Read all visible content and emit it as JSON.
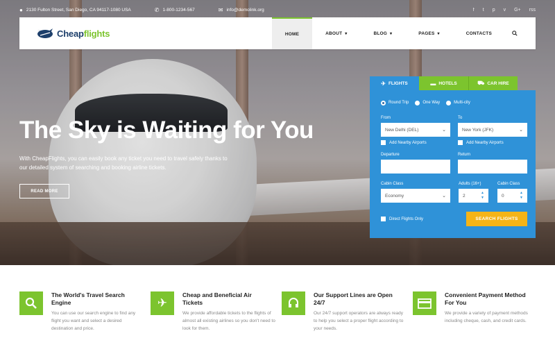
{
  "topbar": {
    "address": "2130 Fulton Street, San Diego, CA 94117-1080 USA",
    "phone": "1-800-1234-567",
    "email": "info@demolink.org",
    "socials": [
      "f",
      "t",
      "p",
      "v",
      "G+",
      "rss"
    ]
  },
  "logo": {
    "part1": "Cheap",
    "part2": "flights"
  },
  "nav": {
    "items": [
      {
        "label": "HOME"
      },
      {
        "label": "ABOUT"
      },
      {
        "label": "BLOG"
      },
      {
        "label": "PAGES"
      },
      {
        "label": "CONTACTS"
      }
    ]
  },
  "hero": {
    "title": "The Sky is Waiting for You",
    "text": "With CheapFlights, you can easily book any ticket you need to travel safely thanks to our detailed system of searching and booking airline tickets.",
    "button": "READ MORE"
  },
  "booking": {
    "tabs": [
      "FLIGHTS",
      "HOTELS",
      "CAR HIRE"
    ],
    "trip_types": [
      "Round Trip",
      "One Way",
      "Multi-city"
    ],
    "from_label": "From",
    "from_value": "New Delhi (DEL)",
    "to_label": "To",
    "to_value": "New York (JFK)",
    "nearby_label": "Add Nearby Airports",
    "departure_label": "Departure",
    "return_label": "Return",
    "cabin_label": "Cabin Class",
    "cabin_value": "Economy",
    "adults_label": "Adults (16+)",
    "adults_value": "2",
    "cabin2_label": "Cabin Class",
    "cabin2_value": "0",
    "direct_label": "Direct Flights Only",
    "search_button": "SEARCH FLIGHTS"
  },
  "features": [
    {
      "title": "The World's Travel Search Engine",
      "text": "You can use our search engine to find any flight you want and select a desired destination and price."
    },
    {
      "title": "Cheap and Beneficial Air Tickets",
      "text": "We provide affordable tickets to the flights of almost all existing airlines so you don't need to look for them."
    },
    {
      "title": "Our Support Lines are Open 24/7",
      "text": "Our 24/7 support operators are always ready to help you select a proper flight according to your needs."
    },
    {
      "title": "Convenient Payment Method For You",
      "text": "We provide a variety of payment methods including cheque, cash, and credit cards."
    }
  ],
  "colors": {
    "brand_green": "#7cc42e",
    "brand_blue": "#2f92d8",
    "accent_yellow": "#f5b417",
    "logo_navy": "#1d3f6b"
  }
}
